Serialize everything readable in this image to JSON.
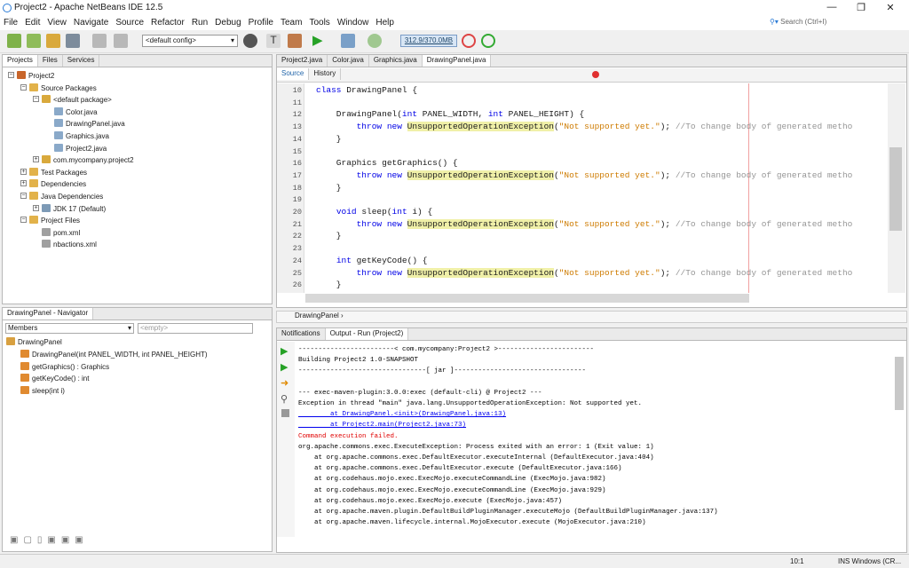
{
  "window": {
    "title": "Project2 - Apache NetBeans IDE 12.5",
    "min_label": "—",
    "max_label": "❐",
    "close_label": "✕"
  },
  "menubar": {
    "items": [
      "File",
      "Edit",
      "View",
      "Navigate",
      "Source",
      "Refactor",
      "Run",
      "Debug",
      "Profile",
      "Team",
      "Tools",
      "Window",
      "Help"
    ]
  },
  "search": {
    "placeholder": "Search (Ctrl+I)"
  },
  "toolbar": {
    "config": "<default config>",
    "memory": "312.9/370.0MB"
  },
  "projects_panel": {
    "tabs": [
      "Projects",
      "Files",
      "Services"
    ],
    "tree": [
      {
        "label": "Project2",
        "depth": 0,
        "icon": "project"
      },
      {
        "label": "Source Packages",
        "depth": 1,
        "icon": "folder"
      },
      {
        "label": "<default package>",
        "depth": 2,
        "icon": "package"
      },
      {
        "label": "Color.java",
        "depth": 3,
        "icon": "java"
      },
      {
        "label": "DrawingPanel.java",
        "depth": 3,
        "icon": "java"
      },
      {
        "label": "Graphics.java",
        "depth": 3,
        "icon": "java"
      },
      {
        "label": "Project2.java",
        "depth": 3,
        "icon": "java"
      },
      {
        "label": "com.mycompany.project2",
        "depth": 2,
        "icon": "package"
      },
      {
        "label": "Test Packages",
        "depth": 1,
        "icon": "folder"
      },
      {
        "label": "Dependencies",
        "depth": 1,
        "icon": "folder"
      },
      {
        "label": "Java Dependencies",
        "depth": 1,
        "icon": "folder"
      },
      {
        "label": "JDK 17 (Default)",
        "depth": 2,
        "icon": "jdk"
      },
      {
        "label": "Project Files",
        "depth": 1,
        "icon": "folder"
      },
      {
        "label": "pom.xml",
        "depth": 2,
        "icon": "xml"
      },
      {
        "label": "nbactions.xml",
        "depth": 2,
        "icon": "xml"
      }
    ]
  },
  "navigator": {
    "title": "DrawingPanel - Navigator",
    "members_label": "Members",
    "filter_placeholder": "<empty>",
    "root": "DrawingPanel",
    "items": [
      "DrawingPanel(int PANEL_WIDTH, int PANEL_HEIGHT)",
      "getGraphics() : Graphics",
      "getKeyCode() : int",
      "sleep(int i)"
    ]
  },
  "editor": {
    "tabs": [
      "Project2.java",
      "Color.java",
      "Graphics.java",
      "DrawingPanel.java"
    ],
    "active_tab": "DrawingPanel.java",
    "source_label": "Source",
    "history_label": "History",
    "breadcrumb": "DrawingPanel",
    "lines": [
      {
        "n": "10",
        "html": "<span class=\"kw\">class</span> DrawingPanel {"
      },
      {
        "n": "11",
        "html": ""
      },
      {
        "n": "12",
        "html": "    DrawingPanel(<span class=\"kw\">int</span> PANEL_WIDTH, <span class=\"kw\">int</span> PANEL_HEIGHT) {"
      },
      {
        "n": "13",
        "html": "        <span class=\"kw\">throw</span> <span class=\"kw\">new</span> <span class=\"hl\">UnsupportedOperationException</span>(<span class=\"str\">\"Not supported yet.\"</span>); <span class=\"cmt\">//To change body of generated metho</span>"
      },
      {
        "n": "14",
        "html": "    }"
      },
      {
        "n": "15",
        "html": ""
      },
      {
        "n": "16",
        "html": "    Graphics getGraphics() {"
      },
      {
        "n": "17",
        "html": "        <span class=\"kw\">throw</span> <span class=\"kw\">new</span> <span class=\"hl\">UnsupportedOperationException</span>(<span class=\"str\">\"Not supported yet.\"</span>); <span class=\"cmt\">//To change body of generated metho</span>"
      },
      {
        "n": "18",
        "html": "    }"
      },
      {
        "n": "19",
        "html": ""
      },
      {
        "n": "20",
        "html": "    <span class=\"kw\">void</span> sleep(<span class=\"kw\">int</span> i) {"
      },
      {
        "n": "21",
        "html": "        <span class=\"kw\">throw</span> <span class=\"kw\">new</span> <span class=\"hl\">UnsupportedOperationException</span>(<span class=\"str\">\"Not supported yet.\"</span>); <span class=\"cmt\">//To change body of generated metho</span>"
      },
      {
        "n": "22",
        "html": "    }"
      },
      {
        "n": "23",
        "html": ""
      },
      {
        "n": "24",
        "html": "    <span class=\"kw\">int</span> getKeyCode() {"
      },
      {
        "n": "25",
        "html": "        <span class=\"kw\">throw</span> <span class=\"kw\">new</span> <span class=\"hl\">UnsupportedOperationException</span>(<span class=\"str\">\"Not supported yet.\"</span>); <span class=\"cmt\">//To change body of generated metho</span>"
      },
      {
        "n": "26",
        "html": "    }"
      }
    ]
  },
  "output": {
    "tabs": [
      "Notifications",
      "Output - Run (Project2)"
    ],
    "lines": [
      {
        "cls": "",
        "text": "------------------------< com.mycompany:Project2 >------------------------"
      },
      {
        "cls": "",
        "text": "Building Project2 1.0-SNAPSHOT"
      },
      {
        "cls": "",
        "text": "--------------------------------[ jar ]---------------------------------"
      },
      {
        "cls": "",
        "text": ""
      },
      {
        "cls": "cmt",
        "text": "--- exec-maven-plugin:3.0.0:exec (default-cli) @ Project2 ---"
      },
      {
        "cls": "",
        "text": "Exception in thread \"main\" java.lang.UnsupportedOperationException: Not supported yet."
      },
      {
        "cls": "link",
        "text": "        at DrawingPanel.<init>(DrawingPanel.java:13)"
      },
      {
        "cls": "link",
        "text": "        at Project2.main(Project2.java:73)"
      },
      {
        "cls": "err",
        "text": "Command execution failed."
      },
      {
        "cls": "",
        "text": "org.apache.commons.exec.ExecuteException: Process exited with an error: 1 (Exit value: 1)"
      },
      {
        "cls": "",
        "text": "    at org.apache.commons.exec.DefaultExecutor.executeInternal (DefaultExecutor.java:404)"
      },
      {
        "cls": "",
        "text": "    at org.apache.commons.exec.DefaultExecutor.execute (DefaultExecutor.java:166)"
      },
      {
        "cls": "",
        "text": "    at org.codehaus.mojo.exec.ExecMojo.executeCommandLine (ExecMojo.java:982)"
      },
      {
        "cls": "",
        "text": "    at org.codehaus.mojo.exec.ExecMojo.executeCommandLine (ExecMojo.java:929)"
      },
      {
        "cls": "",
        "text": "    at org.codehaus.mojo.exec.ExecMojo.execute (ExecMojo.java:457)"
      },
      {
        "cls": "",
        "text": "    at org.apache.maven.plugin.DefaultBuildPluginManager.executeMojo (DefaultBuildPluginManager.java:137)"
      },
      {
        "cls": "",
        "text": "    at org.apache.maven.lifecycle.internal.MojoExecutor.execute (MojoExecutor.java:210)"
      }
    ]
  },
  "status": {
    "position": "10:1",
    "mode": "INS Windows (CR..."
  },
  "colors": {
    "accent": "#2b7bd6",
    "keyword": "#0000e6",
    "string": "#ce7b00",
    "error": "#e00000",
    "highlight": "#f0f0a8"
  }
}
